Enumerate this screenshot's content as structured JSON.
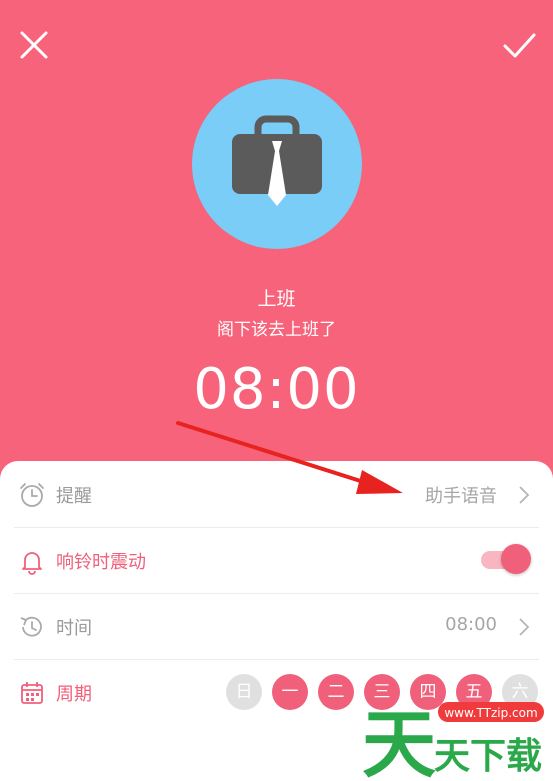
{
  "header": {
    "close_icon": "close-icon",
    "confirm_icon": "check-icon",
    "avatar_icon": "briefcase-tie-icon",
    "title": "上班",
    "subtitle": "阁下该去上班了",
    "time": "08:00"
  },
  "colors": {
    "primary": "#f7637a",
    "accent": "#f0607a",
    "avatar_bg": "#79cdf6",
    "arrow": "#e8231f"
  },
  "settings": {
    "reminder": {
      "icon": "alarm-clock-icon",
      "label": "提醒",
      "value": "助手语音"
    },
    "vibrate": {
      "icon": "bell-icon",
      "label": "响铃时震动",
      "enabled": true
    },
    "time": {
      "icon": "clock-history-icon",
      "label": "时间",
      "value": "08:00"
    },
    "cycle": {
      "icon": "calendar-icon",
      "label": "周期",
      "days": [
        {
          "label": "日",
          "selected": false
        },
        {
          "label": "一",
          "selected": true
        },
        {
          "label": "二",
          "selected": true
        },
        {
          "label": "三",
          "selected": true
        },
        {
          "label": "四",
          "selected": true
        },
        {
          "label": "五",
          "selected": true
        },
        {
          "label": "六",
          "selected": false
        }
      ]
    }
  },
  "watermark": {
    "url": "www.TTzip.com",
    "glyph": "天",
    "text": "天下载"
  }
}
